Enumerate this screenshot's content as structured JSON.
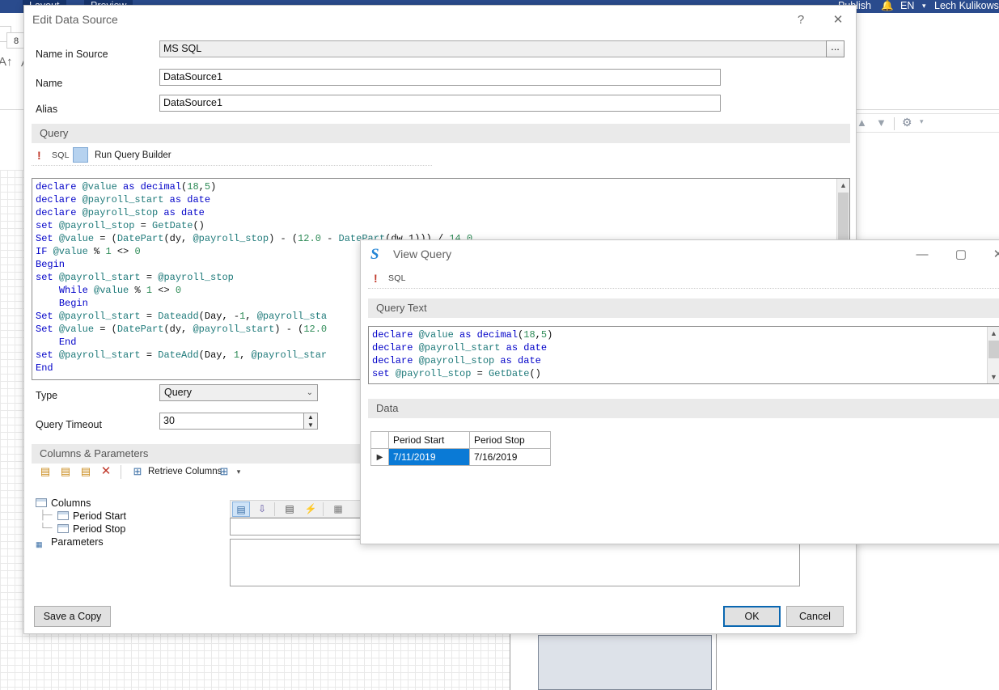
{
  "background": {
    "topbar": {
      "tab_layout": "Layout",
      "tab_preview": "Preview",
      "publish": "Publish",
      "bell_icon": "bell-icon",
      "language": "EN",
      "language_caret": "▾",
      "user": "Lech Kulikowski"
    },
    "ribbon": {
      "size_value": "8",
      "font_grow_icon": "font-grow-icon",
      "font_shrink_icon": "font-shrink-icon",
      "left_glyph": "A"
    },
    "right_toolbar": {
      "move_up_icon": "arrow-up-icon",
      "move_down_icon": "arrow-down-icon",
      "settings_icon": "gear-icon",
      "settings_caret": "▾"
    }
  },
  "edit_data_source": {
    "title": "Edit Data Source",
    "help_label": "?",
    "close_label": "✕",
    "fields": {
      "name_in_source_label": "Name in Source",
      "name_in_source_value": "MS SQL",
      "name_in_source_browse": "...",
      "name_label": "Name",
      "name_value": "DataSource1",
      "alias_label": "Alias",
      "alias_value": "DataSource1"
    },
    "query_section": {
      "header": "Query",
      "error_icon": "error-exclamation-icon",
      "sql_tag": "SQL",
      "query_builder_icon": "query-builder-icon",
      "run_query_builder": "Run Query Builder"
    },
    "sql_lines": [
      [
        [
          "kw",
          "declare "
        ],
        [
          "var",
          "@value"
        ],
        [
          "kw",
          " as decimal"
        ],
        [
          "pl",
          "("
        ],
        [
          "num",
          "18"
        ],
        [
          "pl",
          ","
        ],
        [
          "num",
          "5"
        ],
        [
          "pl",
          ")"
        ]
      ],
      [
        [
          "kw",
          "declare "
        ],
        [
          "var",
          "@payroll_start"
        ],
        [
          "kw",
          " as date"
        ]
      ],
      [
        [
          "kw",
          "declare "
        ],
        [
          "var",
          "@payroll_stop"
        ],
        [
          "kw",
          " as date"
        ]
      ],
      [
        [
          "kw",
          "set "
        ],
        [
          "var",
          "@payroll_stop"
        ],
        [
          "pl",
          " = "
        ],
        [
          "var",
          "GetDate"
        ],
        [
          "pl",
          "()"
        ]
      ],
      [
        [
          "kw",
          "Set "
        ],
        [
          "var",
          "@value"
        ],
        [
          "pl",
          " = ("
        ],
        [
          "var",
          "DatePart"
        ],
        [
          "pl",
          "(dy, "
        ],
        [
          "var",
          "@payroll_stop"
        ],
        [
          "pl",
          ") - ("
        ],
        [
          "num",
          "12.0"
        ],
        [
          "pl",
          " - "
        ],
        [
          "var",
          "DatePart"
        ],
        [
          "pl",
          "(dw,1))) / "
        ],
        [
          "num",
          "14.0"
        ]
      ],
      [
        [
          "kw",
          "IF "
        ],
        [
          "var",
          "@value"
        ],
        [
          "pl",
          " % "
        ],
        [
          "num",
          "1"
        ],
        [
          "pl",
          " <> "
        ],
        [
          "num",
          "0"
        ]
      ],
      [
        [
          "kw",
          "Begin"
        ]
      ],
      [
        [
          "kw",
          "set "
        ],
        [
          "var",
          "@payroll_start"
        ],
        [
          "pl",
          " = "
        ],
        [
          "var",
          "@payroll_stop"
        ]
      ],
      [
        [
          "pl",
          "    "
        ],
        [
          "kw",
          "While "
        ],
        [
          "var",
          "@value"
        ],
        [
          "pl",
          " % "
        ],
        [
          "num",
          "1"
        ],
        [
          "pl",
          " <> "
        ],
        [
          "num",
          "0"
        ]
      ],
      [
        [
          "pl",
          "    "
        ],
        [
          "kw",
          "Begin"
        ]
      ],
      [
        [
          "kw",
          "Set "
        ],
        [
          "var",
          "@payroll_start"
        ],
        [
          "pl",
          " = "
        ],
        [
          "var",
          "Dateadd"
        ],
        [
          "pl",
          "(Day, -"
        ],
        [
          "num",
          "1"
        ],
        [
          "pl",
          ", "
        ],
        [
          "var",
          "@payroll_sta"
        ]
      ],
      [
        [
          "kw",
          "Set "
        ],
        [
          "var",
          "@value"
        ],
        [
          "pl",
          " = ("
        ],
        [
          "var",
          "DatePart"
        ],
        [
          "pl",
          "(dy, "
        ],
        [
          "var",
          "@payroll_start"
        ],
        [
          "pl",
          ") - ("
        ],
        [
          "num",
          "12.0"
        ]
      ],
      [
        [
          "pl",
          "    "
        ],
        [
          "kw",
          "End"
        ]
      ],
      [
        [
          "kw",
          "set "
        ],
        [
          "var",
          "@payroll_start"
        ],
        [
          "pl",
          " = "
        ],
        [
          "var",
          "DateAdd"
        ],
        [
          "pl",
          "(Day, "
        ],
        [
          "num",
          "1"
        ],
        [
          "pl",
          ", "
        ],
        [
          "var",
          "@payroll_star"
        ]
      ],
      [
        [
          "kw",
          "End"
        ]
      ]
    ],
    "scrollbar": {
      "up_arrow": "▲",
      "down_arrow": "▼"
    },
    "type_label": "Type",
    "type_value": "Query",
    "type_caret": "⌄",
    "timeout_label": "Query Timeout",
    "timeout_value": "30",
    "spin_up": "▲",
    "spin_down": "▼",
    "columns_params": {
      "header": "Columns & Parameters",
      "toolbar": [
        {
          "name": "add-column-icon",
          "glyph": "▤"
        },
        {
          "name": "edit-column-icon",
          "glyph": "▥"
        },
        {
          "name": "add-parameter-icon",
          "glyph": "▦"
        },
        {
          "name": "delete-icon",
          "glyph": "✕"
        },
        {
          "name": "retrieve-columns-icon",
          "glyph": "⊞"
        },
        {
          "name": "add-dropdown-icon",
          "glyph": "⊞"
        }
      ],
      "retrieve_columns_label": "Retrieve Columns",
      "retrieve_caret": "▾",
      "tree": {
        "columns_node": "Columns",
        "children": [
          "Period Start",
          "Period Stop"
        ],
        "parameters_node": "Parameters"
      },
      "property_toolbar": [
        {
          "name": "categorized-view-icon",
          "glyph": "▤",
          "selected": true
        },
        {
          "name": "alphabetical-sort-icon",
          "glyph": "↓",
          "selected": false
        },
        {
          "name": "properties-icon",
          "glyph": "▤",
          "selected": false
        },
        {
          "name": "events-icon",
          "glyph": "⚡",
          "selected": false
        },
        {
          "name": "property-pages-icon",
          "glyph": "▣",
          "selected": false
        }
      ]
    },
    "buttons": {
      "save_a_copy": "Save a Copy",
      "ok": "OK",
      "cancel": "Cancel"
    }
  },
  "view_query": {
    "title": "View Query",
    "logo_icon": "stimulsoft-logo-icon",
    "minimize_label": "—",
    "maximize_label": "▢",
    "close_label": "✕",
    "toolbar": {
      "error_icon": "error-exclamation-icon",
      "sql_tag": "SQL"
    },
    "query_text_header": "Query Text",
    "query_lines": [
      [
        [
          "kw",
          "declare "
        ],
        [
          "var",
          "@value"
        ],
        [
          "kw",
          " as decimal"
        ],
        [
          "pl",
          "("
        ],
        [
          "num",
          "18"
        ],
        [
          "pl",
          ","
        ],
        [
          "num",
          "5"
        ],
        [
          "pl",
          ")"
        ]
      ],
      [
        [
          "kw",
          "declare "
        ],
        [
          "var",
          "@payroll_start"
        ],
        [
          "kw",
          " as date"
        ]
      ],
      [
        [
          "kw",
          "declare "
        ],
        [
          "var",
          "@payroll_stop"
        ],
        [
          "kw",
          " as date"
        ]
      ],
      [
        [
          "kw",
          "set "
        ],
        [
          "var",
          "@payroll_stop"
        ],
        [
          "pl",
          " = "
        ],
        [
          "var",
          "GetDate"
        ],
        [
          "pl",
          "()"
        ]
      ]
    ],
    "data_header": "Data",
    "grid": {
      "row_marker": "▶",
      "columns": [
        "Period Start",
        "Period Stop"
      ],
      "rows": [
        [
          "7/11/2019",
          "7/16/2019"
        ]
      ],
      "selected_cell": {
        "row": 0,
        "col": 0
      }
    }
  }
}
